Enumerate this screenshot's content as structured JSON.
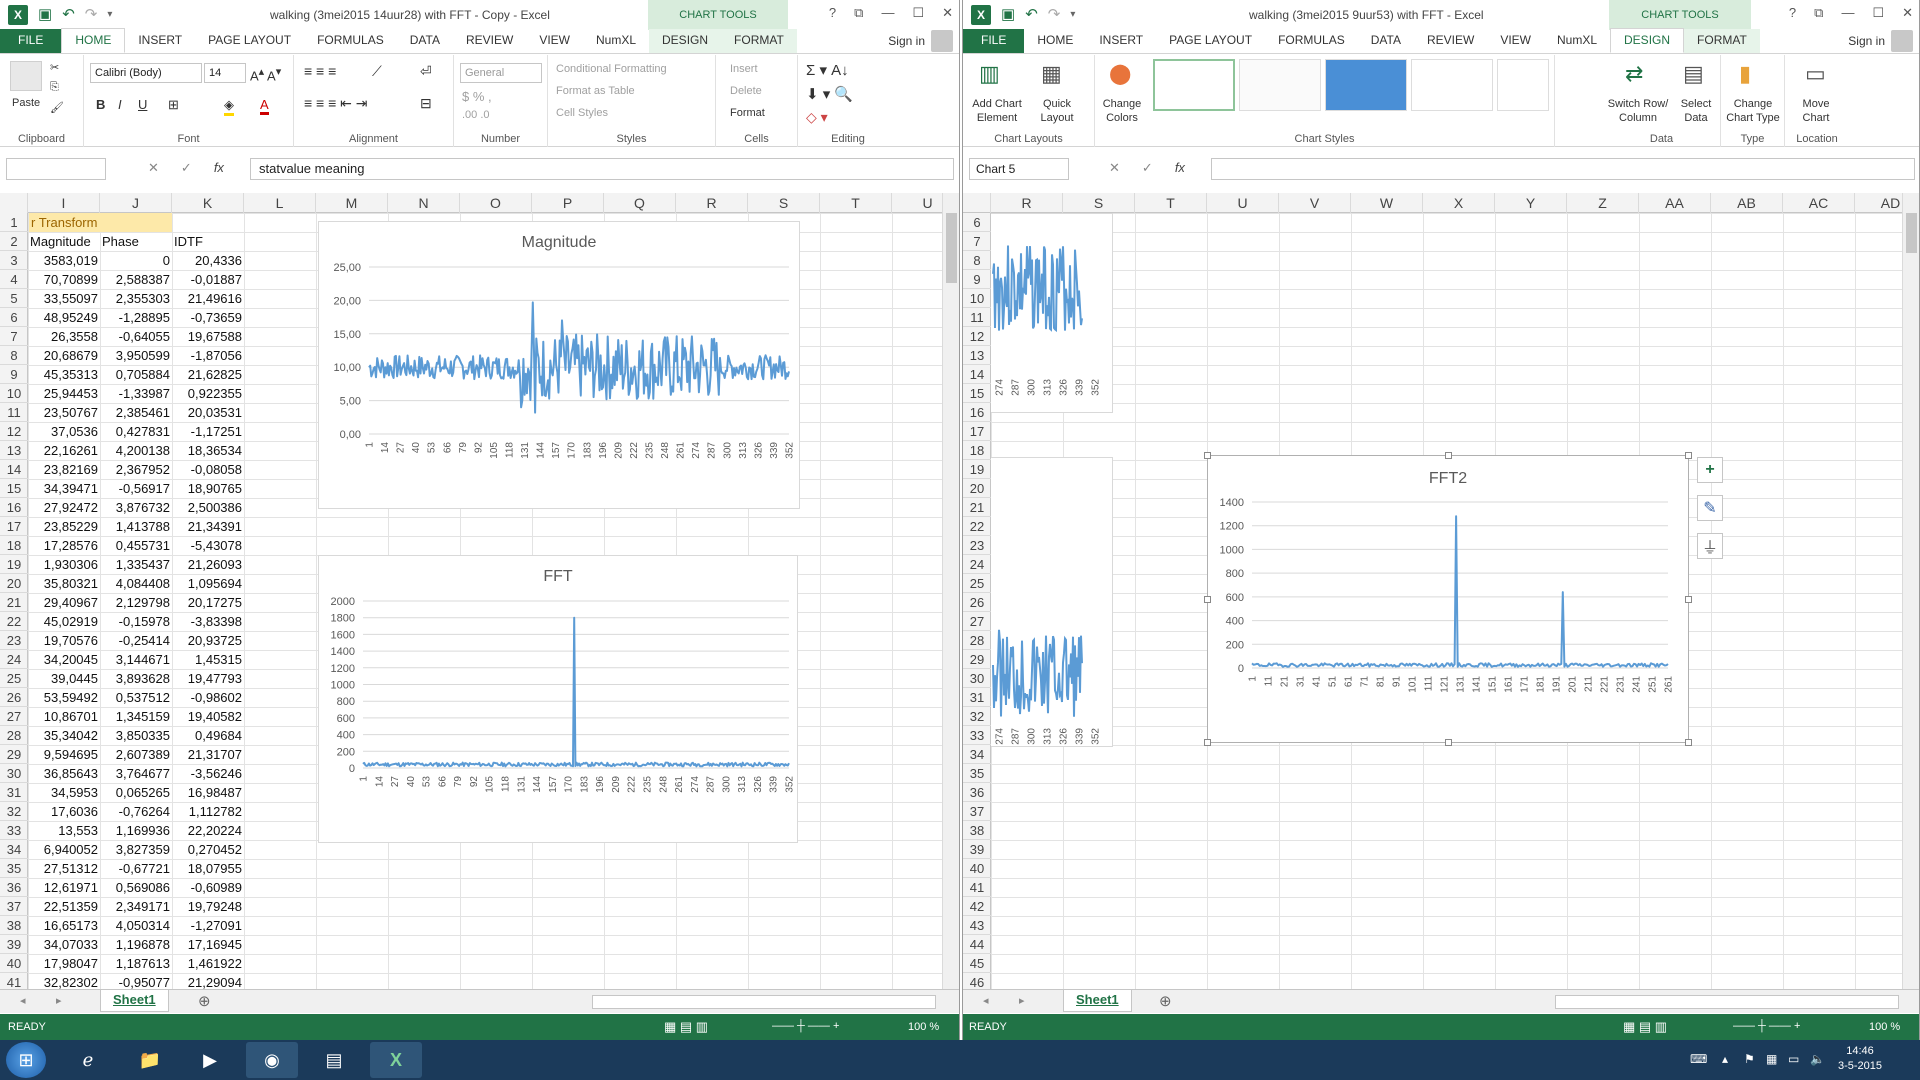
{
  "left": {
    "title": "walking (3mei2015 14uur28) with FFT - Copy - Excel",
    "chart_tools": "CHART TOOLS",
    "tabs": [
      "FILE",
      "HOME",
      "INSERT",
      "PAGE LAYOUT",
      "FORMULAS",
      "DATA",
      "REVIEW",
      "VIEW",
      "NumXL",
      "DESIGN",
      "FORMAT"
    ],
    "sign_in": "Sign in",
    "ribbon": {
      "clipboard": "Clipboard",
      "paste": "Paste",
      "font": "Font",
      "font_name": "Calibri (Body)",
      "font_size": "14",
      "alignment": "Alignment",
      "number": "Number",
      "number_format": "General",
      "styles": "Styles",
      "cond_fmt": "Conditional Formatting",
      "fmt_table": "Format as Table",
      "cell_styles": "Cell Styles",
      "cells": "Cells",
      "insert": "Insert",
      "delete": "Delete",
      "format": "Format",
      "editing": "Editing"
    },
    "name_box": "",
    "formula": "statvalue meaning",
    "columns": [
      "I",
      "J",
      "K",
      "L",
      "M",
      "N",
      "O",
      "P",
      "Q",
      "R",
      "S",
      "T",
      "U"
    ],
    "header_text": "r Transform",
    "col_headers": [
      "Magnitude",
      "Phase",
      "IDTF"
    ],
    "rows": [
      [
        "3583,019",
        "0",
        "20,4336"
      ],
      [
        "70,70899",
        "2,588387",
        "-0,01887"
      ],
      [
        "33,55097",
        "2,355303",
        "21,49616"
      ],
      [
        "48,95249",
        "-1,28895",
        "-0,73659"
      ],
      [
        "26,3558",
        "-0,64055",
        "19,67588"
      ],
      [
        "20,68679",
        "3,950599",
        "-1,87056"
      ],
      [
        "45,35313",
        "0,705884",
        "21,62825"
      ],
      [
        "25,94453",
        "-1,33987",
        "0,922355"
      ],
      [
        "23,50767",
        "2,385461",
        "20,03531"
      ],
      [
        "37,0536",
        "0,427831",
        "-1,17251"
      ],
      [
        "22,16261",
        "4,200138",
        "18,36534"
      ],
      [
        "23,82169",
        "2,367952",
        "-0,08058"
      ],
      [
        "34,39471",
        "-0,56917",
        "18,90765"
      ],
      [
        "27,92472",
        "3,876732",
        "2,500386"
      ],
      [
        "23,85229",
        "1,413788",
        "21,34391"
      ],
      [
        "17,28576",
        "0,455731",
        "-5,43078"
      ],
      [
        "1,930306",
        "1,335437",
        "21,26093"
      ],
      [
        "35,80321",
        "4,084408",
        "1,095694"
      ],
      [
        "29,40967",
        "2,129798",
        "20,17275"
      ],
      [
        "45,02919",
        "-0,15978",
        "-3,83398"
      ],
      [
        "19,70576",
        "-0,25414",
        "20,93725"
      ],
      [
        "34,20045",
        "3,144671",
        "1,45315"
      ],
      [
        "39,0445",
        "3,893628",
        "19,47793"
      ],
      [
        "53,59492",
        "0,537512",
        "-0,98602"
      ],
      [
        "10,86701",
        "1,345159",
        "19,40582"
      ],
      [
        "35,34042",
        "3,850335",
        "0,49684"
      ],
      [
        "9,594695",
        "2,607389",
        "21,31707"
      ],
      [
        "36,85643",
        "3,764677",
        "-3,56246"
      ],
      [
        "34,5953",
        "0,065265",
        "16,98487"
      ],
      [
        "17,6036",
        "-0,76264",
        "1,112782"
      ],
      [
        "13,553",
        "1,169936",
        "22,20224"
      ],
      [
        "6,940052",
        "3,827359",
        "0,270452"
      ],
      [
        "27,51312",
        "-0,67721",
        "18,07955"
      ],
      [
        "12,61971",
        "0,569086",
        "-0,60989"
      ],
      [
        "22,51359",
        "2,349171",
        "19,79248"
      ],
      [
        "16,65173",
        "4,050314",
        "-1,27091"
      ],
      [
        "34,07033",
        "1,196878",
        "17,16945"
      ],
      [
        "17,98047",
        "1,187613",
        "1,461922"
      ],
      [
        "32,82302",
        "-0,95077",
        "21,29094"
      ]
    ],
    "row_numbers": [
      "1",
      "2",
      "3",
      "4",
      "5",
      "6",
      "7",
      "8",
      "9",
      "10",
      "11",
      "12",
      "13",
      "14",
      "15",
      "16",
      "17",
      "18",
      "19",
      "20",
      "21",
      "22",
      "23",
      "24",
      "25",
      "26",
      "27",
      "28",
      "29",
      "30",
      "31",
      "32",
      "33",
      "34",
      "35",
      "36",
      "37",
      "38",
      "39",
      "40",
      "41"
    ],
    "sheet": "Sheet1",
    "status": "READY",
    "zoom": "100 %"
  },
  "right": {
    "title": "walking (3mei2015 9uur53) with FFT - Excel",
    "chart_tools": "CHART TOOLS",
    "tabs": [
      "FILE",
      "HOME",
      "INSERT",
      "PAGE LAYOUT",
      "FORMULAS",
      "DATA",
      "REVIEW",
      "VIEW",
      "NumXL",
      "DESIGN",
      "FORMAT"
    ],
    "sign_in": "Sign in",
    "ribbon": {
      "add_chart_element": "Add Chart Element",
      "quick_layout": "Quick Layout",
      "change_colors": "Change Colors",
      "chart_layouts": "Chart Layouts",
      "chart_styles": "Chart Styles",
      "switch_row_col": "Switch Row/ Column",
      "select_data": "Select Data",
      "data": "Data",
      "change_chart_type": "Change Chart Type",
      "type": "Type",
      "move_chart": "Move Chart",
      "location": "Location"
    },
    "name_box": "Chart 5",
    "formula": "",
    "columns": [
      "R",
      "S",
      "T",
      "U",
      "V",
      "W",
      "X",
      "Y",
      "Z",
      "AA",
      "AB",
      "AC",
      "AD"
    ],
    "row_numbers": [
      "6",
      "7",
      "8",
      "9",
      "10",
      "11",
      "12",
      "13",
      "14",
      "15",
      "16",
      "17",
      "18",
      "19",
      "20",
      "21",
      "22",
      "23",
      "24",
      "25",
      "26",
      "27",
      "28",
      "29",
      "30",
      "31",
      "32",
      "33",
      "34",
      "35",
      "36",
      "37",
      "38",
      "39",
      "40",
      "41",
      "42",
      "43",
      "44",
      "45",
      "46"
    ],
    "sheet": "Sheet1",
    "status": "READY",
    "zoom": "100 %"
  },
  "taskbar": {
    "time": "14:46",
    "date": "3-5-2015"
  },
  "chart_data": [
    {
      "type": "line",
      "title": "Magnitude",
      "ylim": [
        0,
        25
      ],
      "yticks": [
        "0,00",
        "5,00",
        "10,00",
        "15,00",
        "20,00",
        "25,00"
      ],
      "xticks": [
        "1",
        "14",
        "27",
        "40",
        "53",
        "66",
        "79",
        "92",
        "105",
        "118",
        "131",
        "144",
        "157",
        "170",
        "183",
        "196",
        "209",
        "222",
        "235",
        "248",
        "261",
        "274",
        "287",
        "300",
        "313",
        "326",
        "339",
        "352"
      ],
      "baseline": 10,
      "spikes": [
        [
          140,
          19.7
        ],
        [
          142,
          3.2
        ],
        [
          165,
          17.0
        ],
        [
          130,
          4.0
        ]
      ],
      "color": "#5b9bd5"
    },
    {
      "type": "line",
      "title": "FFT",
      "ylim": [
        0,
        2000
      ],
      "yticks": [
        "0",
        "200",
        "400",
        "600",
        "800",
        "1000",
        "1200",
        "1400",
        "1600",
        "1800",
        "2000"
      ],
      "xticks": [
        "1",
        "14",
        "27",
        "40",
        "53",
        "66",
        "79",
        "92",
        "105",
        "118",
        "131",
        "144",
        "157",
        "170",
        "183",
        "196",
        "209",
        "222",
        "235",
        "248",
        "261",
        "274",
        "287",
        "300",
        "313",
        "326",
        "339",
        "352"
      ],
      "spikes": [
        [
          178,
          1800
        ]
      ],
      "color": "#5b9bd5"
    },
    {
      "type": "line",
      "title": "FFT2",
      "ylim": [
        0,
        1400
      ],
      "yticks": [
        "0",
        "200",
        "400",
        "600",
        "800",
        "1000",
        "1200",
        "1400"
      ],
      "xticks": [
        "1",
        "11",
        "21",
        "31",
        "41",
        "51",
        "61",
        "71",
        "81",
        "91",
        "101",
        "111",
        "121",
        "131",
        "141",
        "151",
        "161",
        "171",
        "181",
        "191",
        "201",
        "211",
        "221",
        "231",
        "241",
        "251",
        "261"
      ],
      "spikes": [
        [
          132,
          1280
        ],
        [
          201,
          640
        ]
      ],
      "color": "#5b9bd5"
    }
  ]
}
